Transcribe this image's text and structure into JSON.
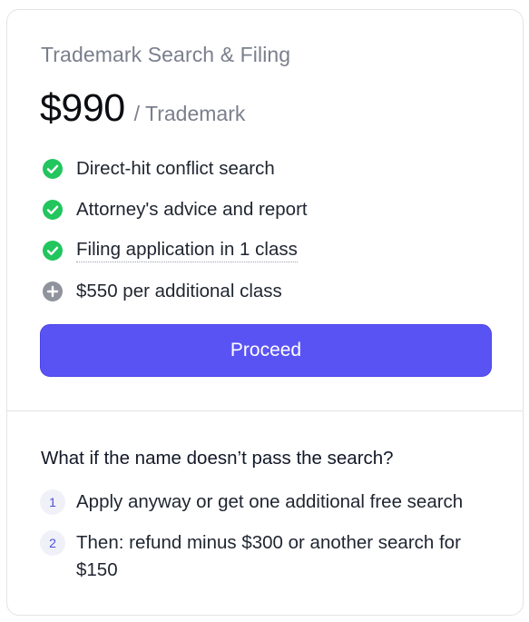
{
  "plan": {
    "title": "Trademark Search & Filing",
    "price": "$990",
    "unit": "/ Trademark"
  },
  "features": [
    {
      "label": "Direct-hit conflict search",
      "icon": "check-circle-icon",
      "color": "#22c55e"
    },
    {
      "label": "Attorney's advice and report",
      "icon": "check-circle-icon",
      "color": "#22c55e"
    },
    {
      "label": "Filing application in 1 class",
      "icon": "check-circle-icon",
      "color": "#22c55e"
    },
    {
      "label": "$550 per additional class",
      "icon": "plus-circle-icon",
      "color": "#8f939c"
    }
  ],
  "cta": {
    "label": "Proceed",
    "color": "#5a53f4"
  },
  "faq": {
    "question": "What if the name doesn’t pass the search?",
    "steps": [
      {
        "num": "1",
        "text": "Apply anyway or get one additional free search"
      },
      {
        "num": "2",
        "text": "Then: refund minus $300 or another search for $150"
      }
    ]
  }
}
